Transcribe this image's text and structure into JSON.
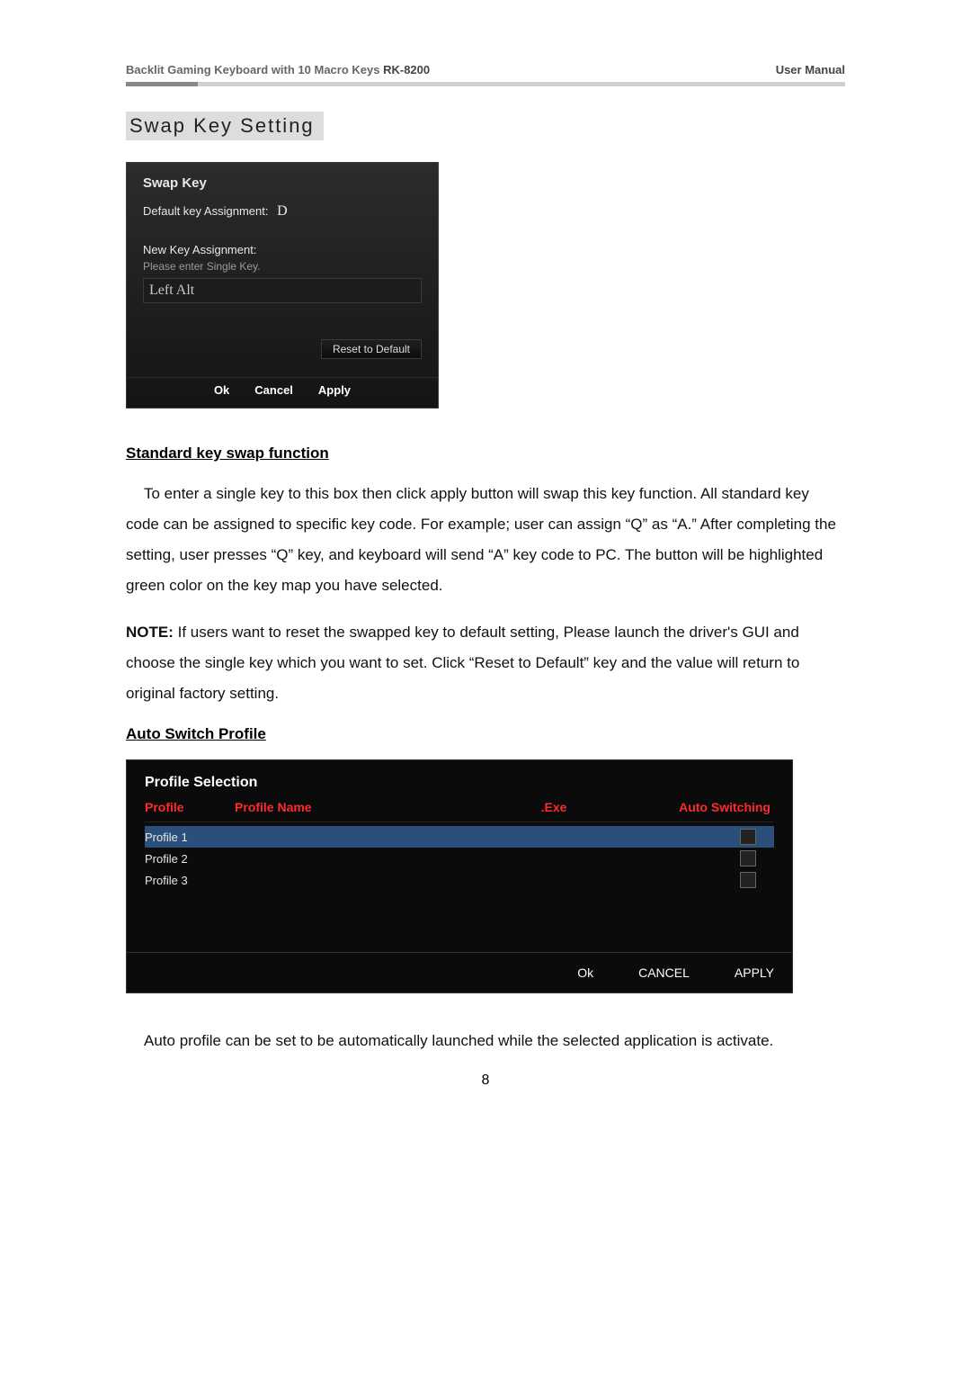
{
  "header": {
    "product_prefix": "Backlit Gaming Keyboard with 10 Macro Keys ",
    "model": "RK-8200",
    "right": "User Manual"
  },
  "section_title": "Swap Key Setting",
  "swap_dialog": {
    "title": "Swap Key",
    "default_label": "Default key Assignment:",
    "default_value": "D",
    "new_label": "New Key Assignment:",
    "hint": "Please enter Single Key.",
    "input_value": "Left Alt",
    "reset": "Reset to Default",
    "ok": "Ok",
    "cancel": "Cancel",
    "apply": "Apply"
  },
  "sub1": "Standard key swap function",
  "para1": "To enter a single key to this box then click apply button will swap this key function. All standard key code can be assigned to specific key code. For example; user can assign “Q” as “A.” After completing the setting, user presses “Q” key, and keyboard will send “A” key code to PC. The button will be highlighted green color on the key map you have selected.",
  "note_label": "NOTE:",
  "para2": " If users want to reset the swapped key to default setting, Please launch the driver's GUI and choose the single key which you want to set. Click “Reset to Default” key and the value will return to original factory setting.",
  "sub2": "Auto Switch Profile",
  "profile_dialog": {
    "title": "Profile Selection",
    "headers": {
      "profile": "Profile",
      "name": "Profile Name",
      "exe": ".Exe",
      "auto": "Auto Switching"
    },
    "rows": [
      {
        "label": "Profile 1",
        "selected": true
      },
      {
        "label": "Profile 2",
        "selected": false
      },
      {
        "label": "Profile 3",
        "selected": false
      }
    ],
    "ok": "Ok",
    "cancel": "CANCEL",
    "apply": "APPLY"
  },
  "para3": "Auto profile can be set to be automatically launched while the selected application is activate.",
  "page_number": "8"
}
